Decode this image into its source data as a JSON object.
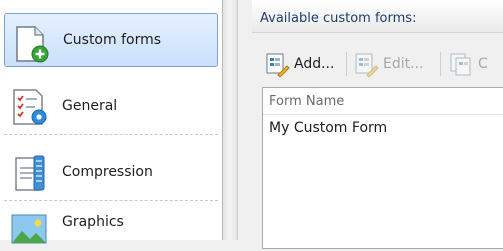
{
  "nav": {
    "items": [
      {
        "label": "Custom forms",
        "icon": "custom-form-add-icon",
        "selected": true
      },
      {
        "label": "General",
        "icon": "general-settings-icon",
        "selected": false
      },
      {
        "label": "Compression",
        "icon": "compression-icon",
        "selected": false
      },
      {
        "label": "Graphics",
        "icon": "graphics-icon",
        "selected": false
      }
    ]
  },
  "panel": {
    "title": "Available custom forms:",
    "toolbar": {
      "add_label": "Add...",
      "edit_label": "Edit...",
      "copy_label": "C"
    },
    "list": {
      "column": "Form Name",
      "rows": [
        "My Custom Form"
      ]
    }
  },
  "colors": {
    "selection": "#c9e0fb",
    "selection_border": "#7da2ce",
    "title_text": "#1e3d6e",
    "disabled_text": "#a8a8a8"
  }
}
